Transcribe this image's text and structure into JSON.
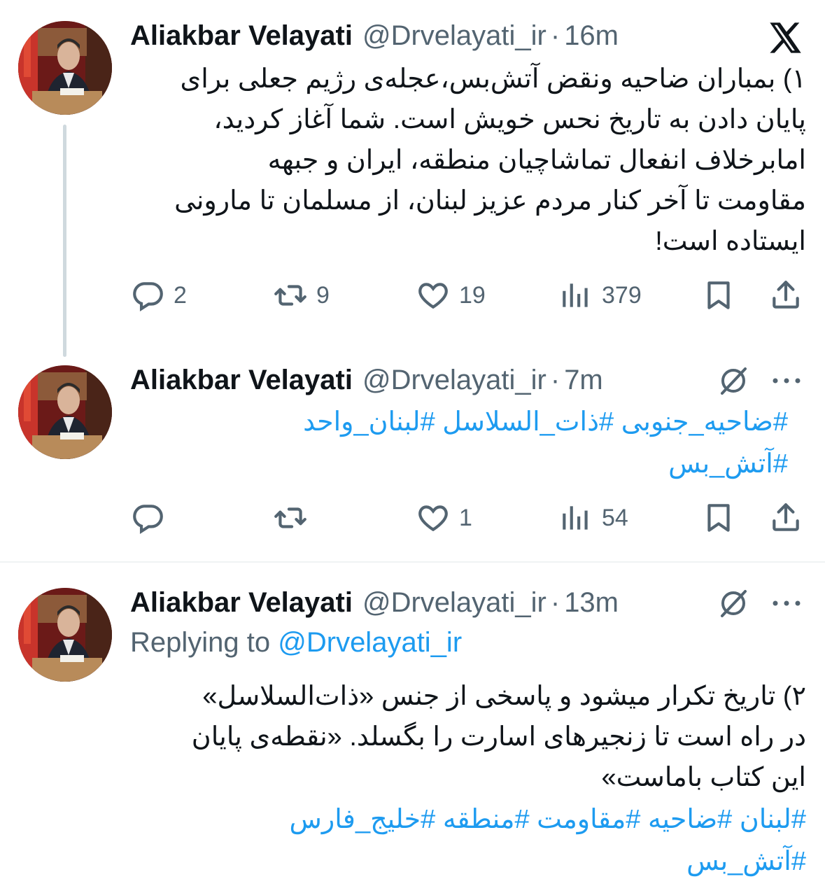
{
  "tweets": [
    {
      "author": "Aliakbar Velayati",
      "handle": "@Drvelayati_ir",
      "dot": "·",
      "time": "16m",
      "text": "۱) بمباران ضاحیه ونقض آتش‌بس،عجله‌ی رژیم جعلی برای\nپایان دادن به تاریخ نحس خویش است. شما آغاز کردید،\nامابرخلاف انفعال تماشاچیان منطقه، ایران و جبهه\nمقاومت تا آخر کنار مردم عزیز لبنان، از مسلمان تا مارونی\nایستاده است!",
      "stats": {
        "replies": "2",
        "reposts": "9",
        "likes": "19",
        "views": "379"
      }
    },
    {
      "author": "Aliakbar Velayati",
      "handle": "@Drvelayati_ir",
      "dot": "·",
      "time": "7m",
      "hashtags_line1": "#ضاحیه_جنوبی #ذات_السلاسل #لبنان_واحد",
      "hashtags_line2": "#آتش_بس",
      "stats": {
        "replies": "",
        "reposts": "",
        "likes": "1",
        "views": "54"
      }
    },
    {
      "author": "Aliakbar Velayati",
      "handle": "@Drvelayati_ir",
      "dot": "·",
      "time": "13m",
      "replying_label": "Replying to",
      "replying_handle": "@Drvelayati_ir",
      "text": "۲) تاریخ تکرار میشود و پاسخی از جنس «ذات‌السلاسل»\nدر راه است تا زنجیرهای اسارت را بگسلد. «نقطه‌ی پایان\nاین کتاب باماست»",
      "hashtags_line1": "#لبنان #ضاحیه #مقاومت #منطقه #خلیج_فارس",
      "hashtags_line2": "#آتش_بس"
    }
  ],
  "icons": {
    "logo": "x-logo-icon",
    "grok": "grok-slash-circle-icon",
    "more": "more-dots-icon",
    "reply": "reply-bubble-icon",
    "repost": "repost-arrows-icon",
    "like": "heart-icon",
    "views": "views-bars-icon",
    "bookmark": "bookmark-icon",
    "share": "share-upload-icon"
  },
  "colors": {
    "accent": "#1d9bf0",
    "secondary": "#536471",
    "text": "#0f1419"
  }
}
